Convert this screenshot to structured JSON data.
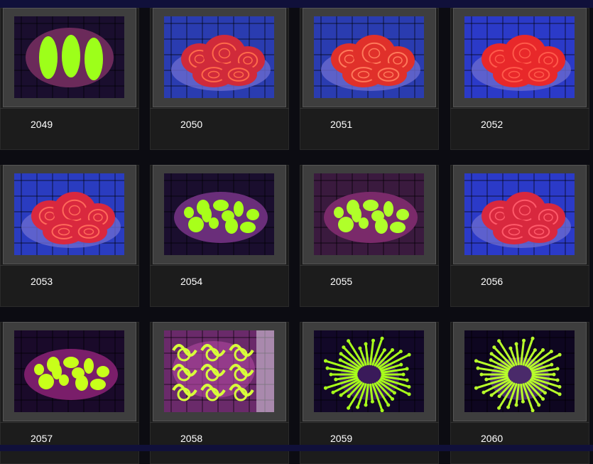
{
  "gallery": {
    "items": [
      {
        "number": "2049",
        "photo": "green-striped-brain-coral-photo",
        "colors": {
          "bg": "#1a0e2e",
          "coral": "#6b2a5a",
          "accent": "#9dff1a"
        }
      },
      {
        "number": "2050",
        "photo": "red-brain-coral-photo",
        "colors": {
          "bg": "#2a3cb0",
          "coral": "#d02a3a",
          "accent": "#ff6b4a"
        }
      },
      {
        "number": "2051",
        "photo": "red-brain-coral-photo",
        "colors": {
          "bg": "#2a3cb0",
          "coral": "#e0302a",
          "accent": "#ff7a5a"
        }
      },
      {
        "number": "2052",
        "photo": "red-brain-coral-photo",
        "colors": {
          "bg": "#2b3ac8",
          "coral": "#e8282a",
          "accent": "#ff5a4a"
        }
      },
      {
        "number": "2053",
        "photo": "red-brain-coral-photo",
        "colors": {
          "bg": "#2a3cc0",
          "coral": "#d9283e",
          "accent": "#ff6a5a"
        }
      },
      {
        "number": "2054",
        "photo": "green-spotted-brain-coral-photo",
        "colors": {
          "bg": "#1a0e2e",
          "coral": "#6a2e7a",
          "accent": "#a8ff1a"
        }
      },
      {
        "number": "2055",
        "photo": "green-spotted-brain-coral-photo",
        "colors": {
          "bg": "#3a1a3e",
          "coral": "#7a2a6a",
          "accent": "#b0ff2a"
        }
      },
      {
        "number": "2056",
        "photo": "red-brain-coral-photo",
        "colors": {
          "bg": "#2b3ac8",
          "coral": "#d8283e",
          "accent": "#ff5a6a"
        }
      },
      {
        "number": "2057",
        "photo": "green-spotted-brain-coral-photo",
        "colors": {
          "bg": "#1a0a2a",
          "coral": "#7a1e6a",
          "accent": "#c8ff1a"
        }
      },
      {
        "number": "2058",
        "photo": "green-maze-coral-photo",
        "colors": {
          "bg": "#6a2a6a",
          "coral": "#b048a0",
          "accent": "#d8ff3a"
        }
      },
      {
        "number": "2059",
        "photo": "green-polyp-coral-photo",
        "colors": {
          "bg": "#120828",
          "coral": "#3a1a5a",
          "accent": "#a8ff1a"
        }
      },
      {
        "number": "2060",
        "photo": "green-polyp-coral-photo",
        "colors": {
          "bg": "#0e0620",
          "coral": "#4a2a6a",
          "accent": "#b8ff2a"
        }
      }
    ]
  }
}
